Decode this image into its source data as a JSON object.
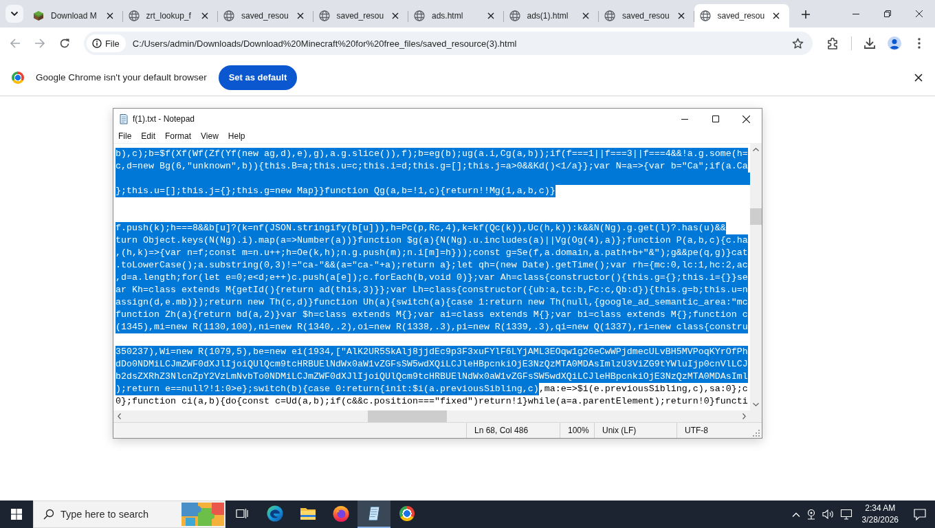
{
  "browser": {
    "tabs": [
      {
        "title": "Download M",
        "kind": "block",
        "selected": false
      },
      {
        "title": "zrt_lookup_f",
        "kind": "page",
        "selected": false
      },
      {
        "title": "saved_resou",
        "kind": "page",
        "selected": false
      },
      {
        "title": "saved_resou",
        "kind": "page",
        "selected": false
      },
      {
        "title": "ads.html",
        "kind": "page",
        "selected": false
      },
      {
        "title": "ads(1).html",
        "kind": "page",
        "selected": false
      },
      {
        "title": "saved_resou",
        "kind": "page",
        "selected": false
      },
      {
        "title": "saved_resou",
        "kind": "page",
        "selected": true
      }
    ],
    "nav_buttons": [
      {
        "kind": "back",
        "disabled": true
      },
      {
        "kind": "forward",
        "disabled": true
      },
      {
        "kind": "reload",
        "disabled": false
      }
    ],
    "address_bar": {
      "scheme_chip": "File",
      "url": "C:/Users/admin/Downloads/Download%20Minecraft%20for%20free_files/saved_resource(3).html"
    },
    "infobar": {
      "message": "Google Chrome isn't your default browser",
      "button": "Set as default"
    }
  },
  "notepad": {
    "title": "f(1).txt - Notepad",
    "menu": [
      "File",
      "Edit",
      "Format",
      "View",
      "Help"
    ],
    "lines": [
      {
        "kind": "text",
        "segments": [
          {
            "text": "b),c);b=$f(Xf(Wf(Zf(Yf(new ag,d),e),g),a.g.slice()),f);b=eg(b);ug(a.i,Cg(a,b));if(f===1||f===3||f===4&&!a.g.some(h=",
            "selected": true
          }
        ]
      },
      {
        "kind": "text",
        "segments": [
          {
            "text": "c,d=new Bg(6,\"unknown\",b)){this.B=a;this.u=c;this.i=d;this.g=[];this.j=a>0&&Kd()<1/a}};var N=a=>{var b=\"Ca\";if(a.Ca",
            "selected": true
          }
        ]
      },
      {
        "kind": "blank",
        "selected": true
      },
      {
        "kind": "text",
        "segments": [
          {
            "text": "};this.u=[];this.j={};this.g=new Map}}function Qg(a,b=!1,c){return!!Mg(1,a,b,c)}",
            "selected": true
          }
        ]
      },
      {
        "kind": "blank",
        "selected": false
      },
      {
        "kind": "blank",
        "selected": false
      },
      {
        "kind": "text",
        "segments": [
          {
            "text": "f.push(k);h===8&&b[u]?(k=nf(JSON.stringify(b[u])),h=Pc(p,Rc,4),k=kf(Qc(k)),Uc(h,k)):k&&N(Ng).g.get(l)?.has(u)&&",
            "selected": true
          }
        ]
      },
      {
        "kind": "text",
        "segments": [
          {
            "text": "turn Object.keys(N(Ng).i).map(a=>Number(a))}function $g(a){N(Ng).u.includes(a)||Vg(Og(4),a)};function P(a,b,c){c.ha",
            "selected": true
          }
        ]
      },
      {
        "kind": "text",
        "segments": [
          {
            "text": ",(h,k)=>{var n=f;const m=n.u++;h=Oe(k,h);n.g.push(m);n.i[m]=h}));const g=Se(f,a.domain,a.path+b+\"&\");g&&pe(q,g)}cat",
            "selected": true
          }
        ]
      },
      {
        "kind": "text",
        "segments": [
          {
            "text": ".toLowerCase();a.substring(0,3)!=\"ca-\"&&(a=\"ca-\"+a);return a};let qh=(new Date).getTime();var rh={mc:0,lc:1,hc:2,ac",
            "selected": true
          }
        ]
      },
      {
        "kind": "text",
        "segments": [
          {
            "text": ",d=a.length;for(let e=0;e<d;e++)c.push(a[e]);c.forEach(b,void 0)};var Ah=class{constructor(){this.g={};this.i={}}se",
            "selected": true
          }
        ]
      },
      {
        "kind": "text",
        "segments": [
          {
            "text": "ar Kh=class extends M{getId(){return ad(this,3)}};var Lh=class{constructor({ub:a,tc:b,Fc:c,Qb:d}){this.g=b;this.u=n",
            "selected": true
          }
        ]
      },
      {
        "kind": "text",
        "segments": [
          {
            "text": "assign(d,e.mb)});return new Th(c,d)}function Uh(a){switch(a){case 1:return new Th(null,{google_ad_semantic_area:\"mc",
            "selected": true
          }
        ]
      },
      {
        "kind": "text",
        "segments": [
          {
            "text": "function Zh(a){return bd(a,2)}var $h=class extends M{};var ai=class extends M{};var bi=class extends M{};function c",
            "selected": true
          }
        ]
      },
      {
        "kind": "text",
        "segments": [
          {
            "text": "(1345),mi=new R(1130,100),ni=new R(1340,.2),oi=new R(1338,.3),pi=new R(1339,.3),qi=new Q(1337),ri=new class{constru",
            "selected": true
          }
        ]
      },
      {
        "kind": "blank",
        "selected": false
      },
      {
        "kind": "text",
        "segments": [
          {
            "text": "350237),Wi=new R(1079,5),be=new ei(1934,[\"AlK2UR5SkAlj8jjdEc9p3F3xuFYlF6LYjAML3EOqw1g26eCwWPjdmecULvBH5MVPoqKYrOfPh",
            "selected": true
          }
        ]
      },
      {
        "kind": "text",
        "segments": [
          {
            "text": "dDo0NDMiLCJmZWF0dXJlIjoiQUlQcm9tcHRBUElNdWx0aW1vZGFsSW5wdXQiLCJleHBpcnkiOjE3NzQzMTA0MDAsImlzU3ViZG9tYWluIjp0cnVlLCJ",
            "selected": true
          }
        ]
      },
      {
        "kind": "text",
        "segments": [
          {
            "text": "b2dsZXRhZ3NlcnZpY2VzLmNvbTo0NDMiLCJmZWF0dXJlIjoiQUlQcm9tcHRBUElNdWx0aW1vZGFsSW5wdXQiLCJleHBpcnkiOjE3NzQzMTA0MDAsIml",
            "selected": true
          }
        ]
      },
      {
        "kind": "text",
        "segments": [
          {
            "text": ");return e==null?!1:0>e};switch(b){case 0:return{init:$i(a.previousSibling,c)",
            "selected": true
          },
          {
            "text": ",ma:e=>$i(e.previousSibling,c),sa:0};c",
            "selected": false
          }
        ]
      },
      {
        "kind": "text",
        "segments": [
          {
            "text": "0};function ci(a,b){do{const c=Ud(a,b);if(c&&c.position===\"fixed\")return!1}while(a=a.parentElement);return!0}functi",
            "selected": false
          }
        ]
      }
    ],
    "status_bar": {
      "position": "Ln 68, Col 486",
      "zoom": "100%",
      "line_ending": "Unix (LF)",
      "encoding": "UTF-8"
    }
  },
  "taskbar": {
    "search": {
      "placeholder": "Type here to search"
    },
    "apps": [
      {
        "kind": "task-view",
        "active": false
      },
      {
        "kind": "edge",
        "active": false
      },
      {
        "kind": "file-explorer",
        "active": false
      },
      {
        "kind": "firefox",
        "active": false
      },
      {
        "kind": "notepad",
        "active": true
      },
      {
        "kind": "chrome",
        "active": false
      }
    ],
    "clock": {
      "time": "2:34 AM",
      "date": "3/28/2026"
    }
  }
}
